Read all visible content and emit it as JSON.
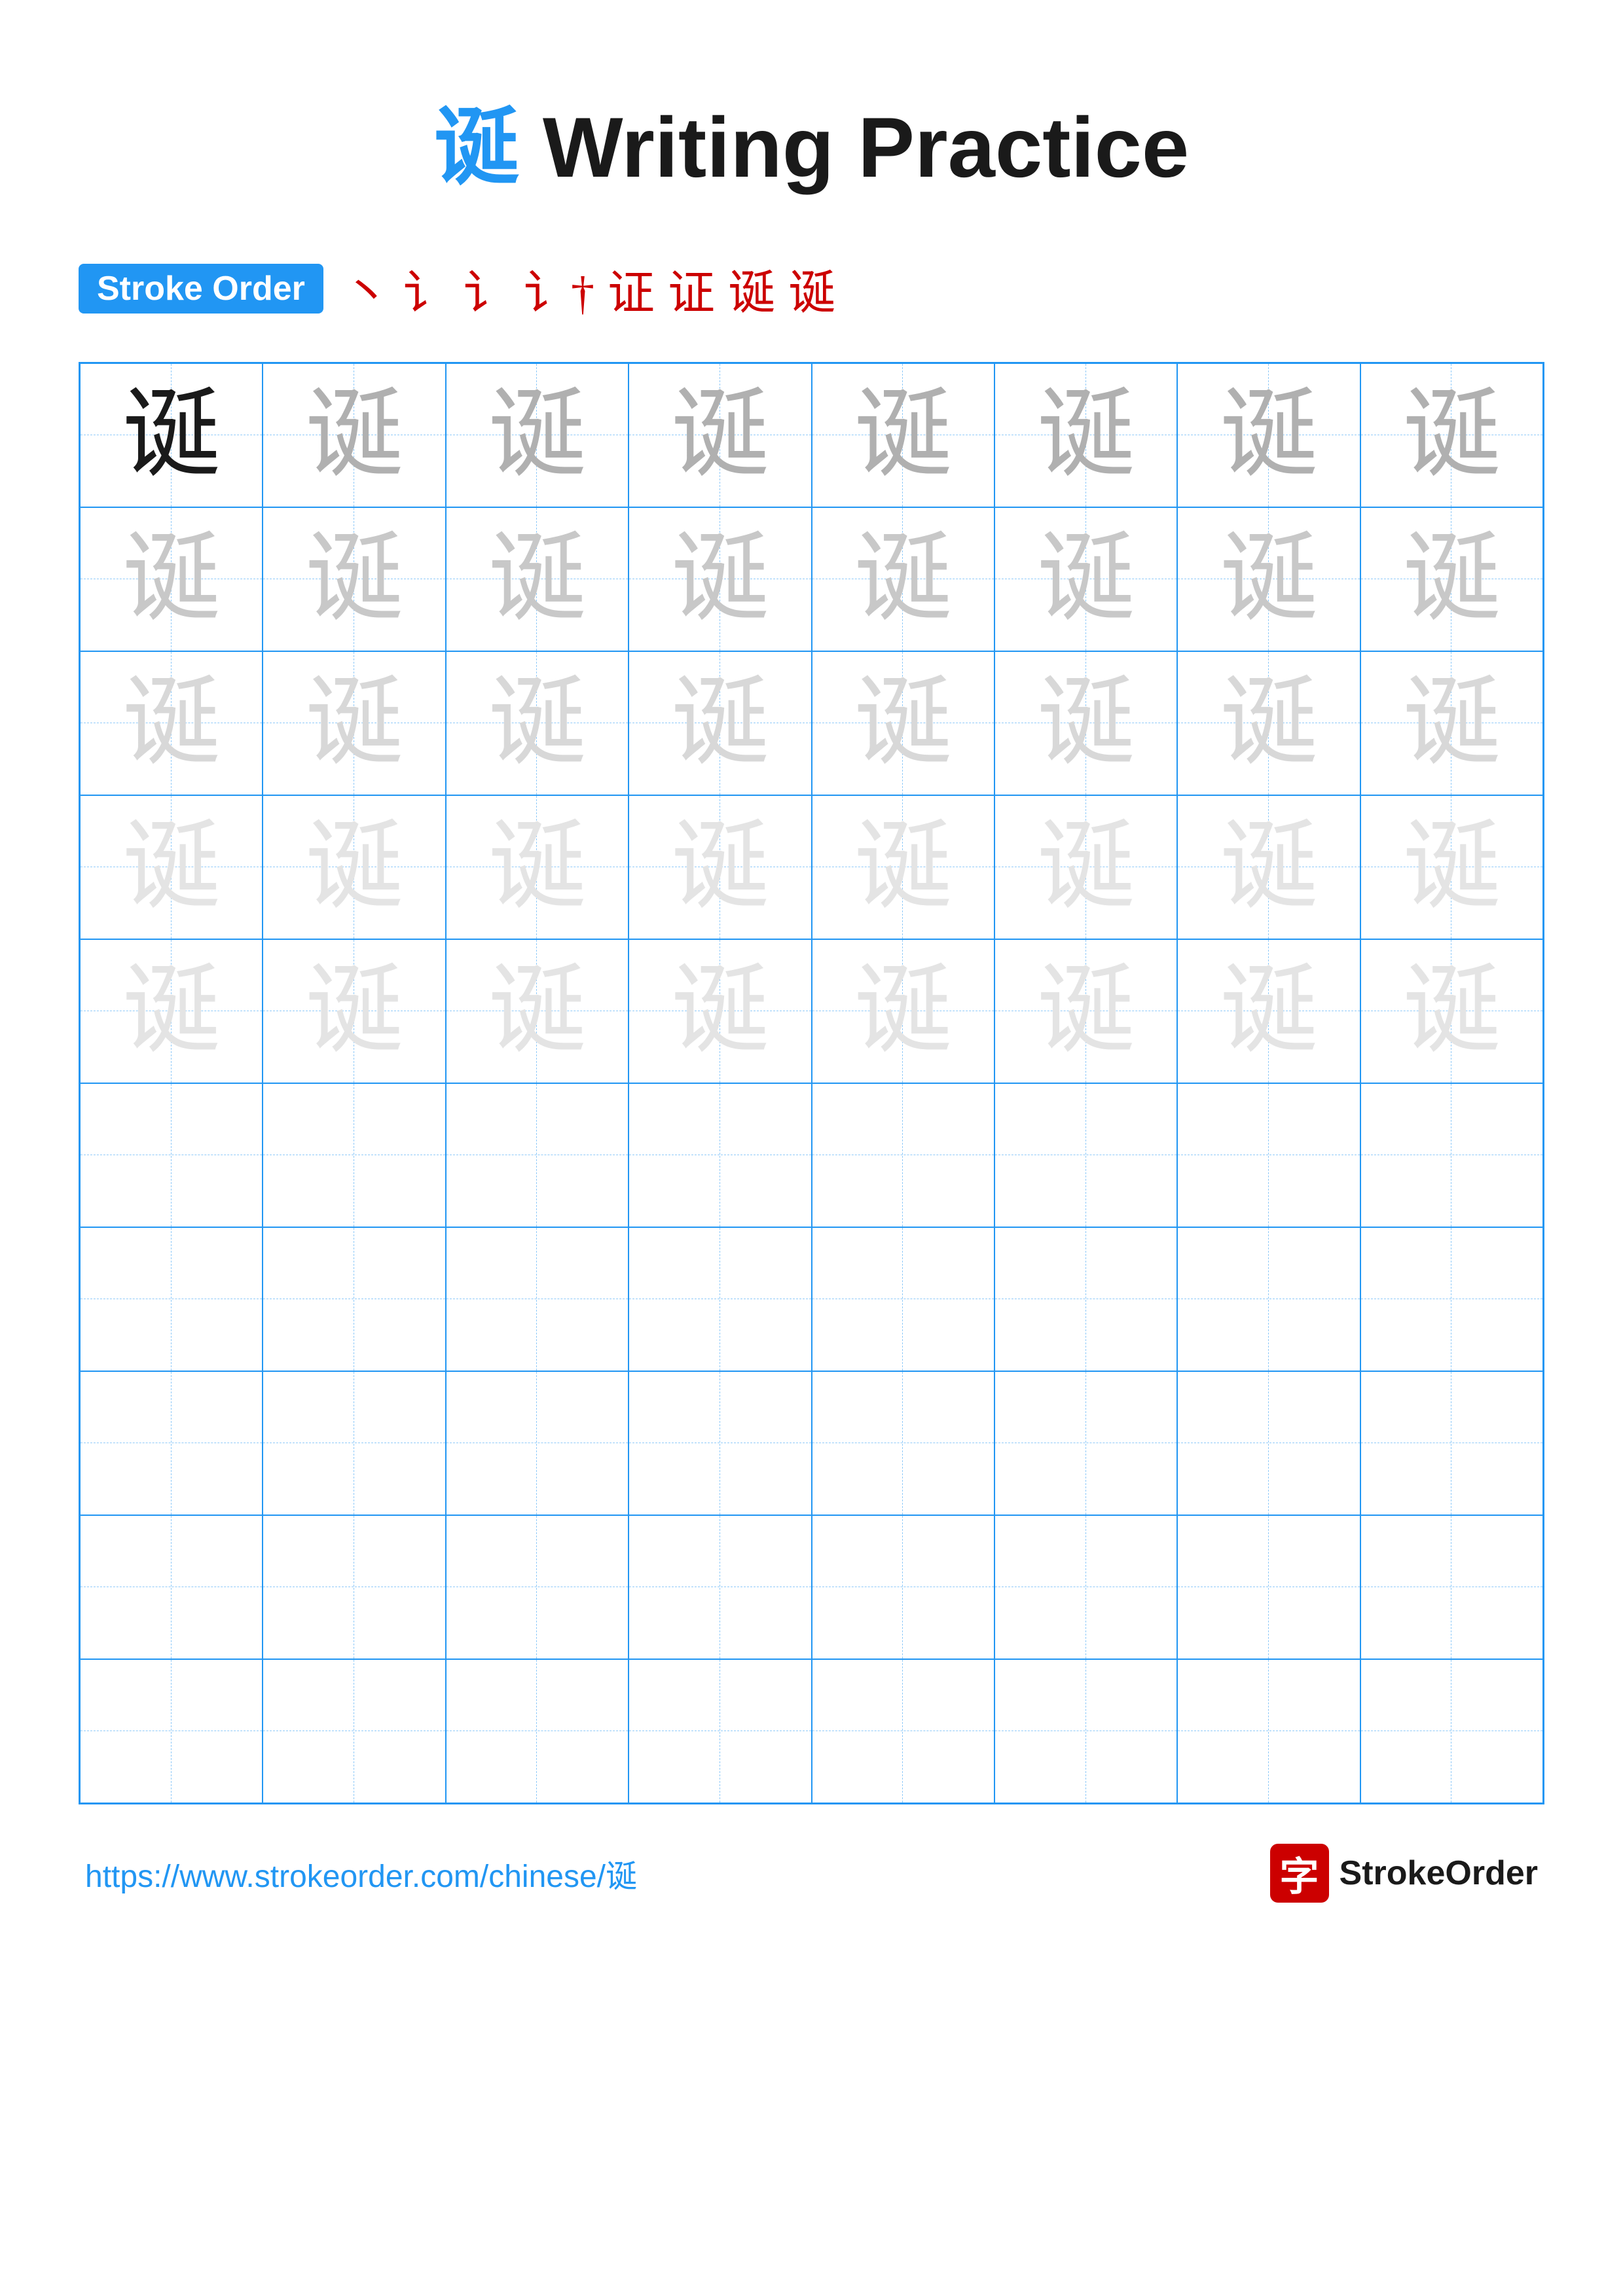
{
  "title": {
    "char": "诞",
    "text": " Writing Practice"
  },
  "stroke_order": {
    "badge_label": "Stroke Order",
    "sequence": [
      "丶",
      "i",
      "i´",
      "i†",
      "i†",
      "证",
      "诞",
      "诞"
    ]
  },
  "grid": {
    "char": "诞",
    "rows": 10,
    "cols": 8,
    "filled_rows": 5,
    "opacity_levels": [
      "dark",
      "light-1",
      "light-2",
      "light-3",
      "light-4"
    ]
  },
  "footer": {
    "url": "https://www.strokeorder.com/chinese/诞",
    "logo_text": "StrokeOrder",
    "logo_char": "字"
  }
}
